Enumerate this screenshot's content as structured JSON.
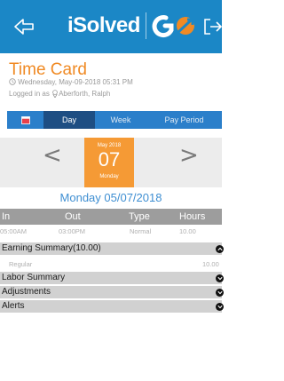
{
  "header": {
    "logo_text": "iSolved",
    "brand_colors": {
      "bar": "#1b87c6",
      "accent": "#f08a24"
    },
    "icons": [
      "back-arrow-icon",
      "logout-icon",
      "go-logo-icon"
    ]
  },
  "page": {
    "title": "Time Card",
    "timestamp": "Wednesday, May-09-2018 05:31 PM",
    "logged_in": "Logged in as",
    "user": "Aberforth, Ralph"
  },
  "tabs": [
    {
      "label": "",
      "icon": "calendar-icon"
    },
    {
      "label": "Day",
      "active": true
    },
    {
      "label": "Week"
    },
    {
      "label": "Pay Period"
    }
  ],
  "date_picker": {
    "month_year": "May 2018",
    "day": "07",
    "weekday": "Monday",
    "prev": "<",
    "next": ">"
  },
  "day_label": "Monday 05/07/2018",
  "table": {
    "columns": [
      "In",
      "Out",
      "Type",
      "Hours"
    ],
    "rows": [
      {
        "in": "05:00AM",
        "out": "03:00PM",
        "type": "Normal",
        "hours": "10.00"
      }
    ]
  },
  "sections": [
    {
      "label": "Earning Summary(10.00)",
      "rows": [
        {
          "label": "Regular",
          "value": "10.00"
        }
      ]
    },
    {
      "label": "Labor Summary"
    },
    {
      "label": "Adjustments"
    },
    {
      "label": "Alerts"
    }
  ]
}
